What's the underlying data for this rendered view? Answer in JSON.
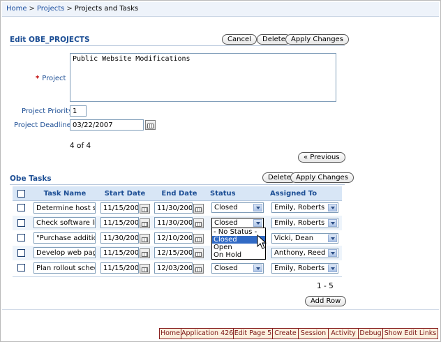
{
  "breadcrumb": {
    "home": "Home",
    "projects": "Projects",
    "separator": ">",
    "current": "Projects and Tasks"
  },
  "edit_region": {
    "title": "Edit OBE_PROJECTS",
    "buttons": {
      "cancel": "Cancel",
      "delete": "Delete",
      "apply": "Apply Changes"
    },
    "project": {
      "required_mark": "*",
      "label": "Project",
      "value": "Public Website Modifications"
    },
    "priority": {
      "label": "Project Priority",
      "value": "1"
    },
    "deadline": {
      "label": "Project Deadline",
      "value": "03/22/2007"
    },
    "pagination": "4 of 4",
    "previous_button": "« Previous"
  },
  "tasks_region": {
    "title": "Obe Tasks",
    "buttons": {
      "delete": "Delete",
      "apply": "Apply Changes"
    },
    "columns": [
      "Task Name",
      "Start Date",
      "End Date",
      "Status",
      "Assigned To"
    ],
    "rows": [
      {
        "task": "Determine host serve",
        "start": "11/15/200",
        "end": "11/30/200",
        "status": "Closed",
        "assigned": "Emily, Roberts"
      },
      {
        "task": "Check software licer",
        "start": "11/15/200",
        "end": "11/30/200",
        "status": "Closed",
        "assigned": "Emily, Roberts"
      },
      {
        "task": "\"Purchase additional",
        "start": "11/30/200",
        "end": "12/10/200",
        "status": "Closed",
        "assigned": "Vicki, Dean"
      },
      {
        "task": "Develop web pages",
        "start": "11/15/200",
        "end": "12/15/200",
        "status": "Closed",
        "assigned": "Anthony, Reed"
      },
      {
        "task": "Plan rollout schedule",
        "start": "11/15/200",
        "end": "12/03/200",
        "status": "Closed",
        "assigned": "Emily, Roberts"
      }
    ],
    "status_options": [
      "- No Status -",
      "Closed",
      "Open",
      "On Hold"
    ],
    "status_highlighted": "Closed",
    "row_range": "1 - 5",
    "add_row_button": "Add Row"
  },
  "developer_toolbar": [
    "Home",
    "Application 426",
    "Edit Page 5",
    "Create",
    "Session",
    "Activity",
    "Debug",
    "Show Edit Links"
  ],
  "colors": {
    "label_blue": "#1b4d94",
    "header_bg": "#d8e6f6",
    "dev_bar_border": "#8a2222",
    "dropdown_highlight": "#316ac5"
  }
}
